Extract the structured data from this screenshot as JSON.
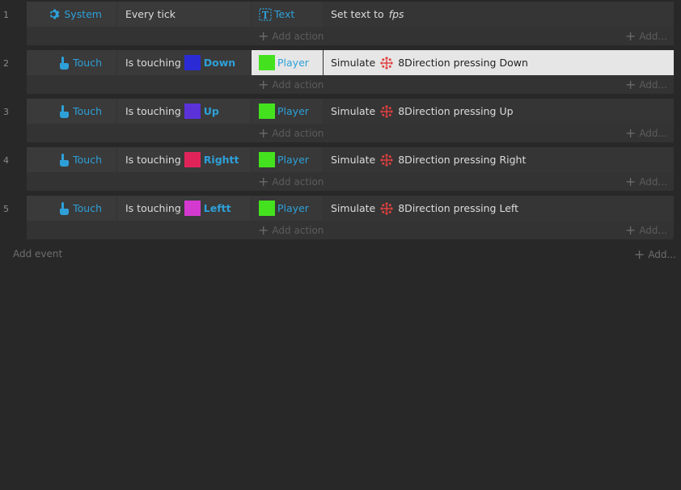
{
  "events": [
    {
      "num": "1",
      "cond_obj": "System",
      "cond_icon": "gear-icon",
      "cond_text": "Every tick",
      "cond_extra": "",
      "cond_swatch": "",
      "act_obj": "Text",
      "act_icon": "text-object-icon",
      "act_swatch": "",
      "act_pre": "Set text to",
      "act_post": "",
      "act_italic": "fps",
      "act_has_dir": false,
      "highlight": false
    },
    {
      "num": "2",
      "cond_obj": "Touch",
      "cond_icon": "touch-icon",
      "cond_text": "Is touching",
      "cond_extra": "Down",
      "cond_swatch": "#2b2bd6",
      "act_obj": "Player",
      "act_icon": "",
      "act_swatch": "#44e21e",
      "act_pre": "Simulate",
      "act_post": "8Direction pressing Down",
      "act_italic": "",
      "act_has_dir": true,
      "highlight": true
    },
    {
      "num": "3",
      "cond_obj": "Touch",
      "cond_icon": "touch-icon",
      "cond_text": "Is touching",
      "cond_extra": "Up",
      "cond_swatch": "#5a32d8",
      "act_obj": "Player",
      "act_icon": "",
      "act_swatch": "#44e21e",
      "act_pre": "Simulate",
      "act_post": "8Direction pressing Up",
      "act_italic": "",
      "act_has_dir": true,
      "highlight": false
    },
    {
      "num": "4",
      "cond_obj": "Touch",
      "cond_icon": "touch-icon",
      "cond_text": "Is touching",
      "cond_extra": "Rightt",
      "cond_swatch": "#e0245a",
      "act_obj": "Player",
      "act_icon": "",
      "act_swatch": "#44e21e",
      "act_pre": "Simulate",
      "act_post": "8Direction pressing Right",
      "act_italic": "",
      "act_has_dir": true,
      "highlight": false
    },
    {
      "num": "5",
      "cond_obj": "Touch",
      "cond_icon": "touch-icon",
      "cond_text": "Is touching",
      "cond_extra": "Leftt",
      "cond_swatch": "#d43ad0",
      "act_obj": "Player",
      "act_icon": "",
      "act_swatch": "#44e21e",
      "act_pre": "Simulate",
      "act_post": "8Direction pressing Left",
      "act_italic": "",
      "act_has_dir": true,
      "highlight": false
    }
  ],
  "labels": {
    "add_action": "Add action",
    "add": "Add...",
    "add_event": "Add event"
  },
  "colors": {
    "accent": "#2ea0d8",
    "dir_icon": "#e04040"
  }
}
